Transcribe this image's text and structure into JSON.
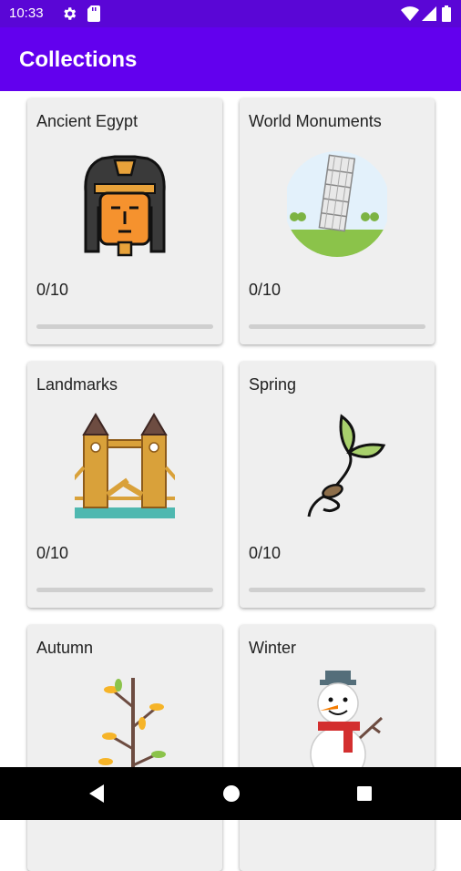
{
  "status_bar": {
    "time": "10:33",
    "icons": [
      "gear-icon",
      "sd-card-icon",
      "wifi-icon",
      "signal-icon",
      "battery-icon"
    ]
  },
  "app_bar": {
    "title": "Collections",
    "color": "#6200ee"
  },
  "collections": [
    {
      "name": "Ancient Egypt",
      "progress_text": "0/10",
      "progress": 0,
      "icon": "pharaoh-icon"
    },
    {
      "name": "World Monuments",
      "progress_text": "0/10",
      "progress": 0,
      "icon": "leaning-tower-icon"
    },
    {
      "name": "Landmarks",
      "progress_text": "0/10",
      "progress": 0,
      "icon": "tower-bridge-icon"
    },
    {
      "name": "Spring",
      "progress_text": "0/10",
      "progress": 0,
      "icon": "sprout-icon"
    },
    {
      "name": "Autumn",
      "progress_text": "",
      "progress": 0,
      "icon": "autumn-branch-icon"
    },
    {
      "name": "Winter",
      "progress_text": "",
      "progress": 0,
      "icon": "snowman-icon"
    }
  ],
  "nav_bar": {
    "buttons": [
      "back-icon",
      "home-icon",
      "recents-icon"
    ]
  }
}
